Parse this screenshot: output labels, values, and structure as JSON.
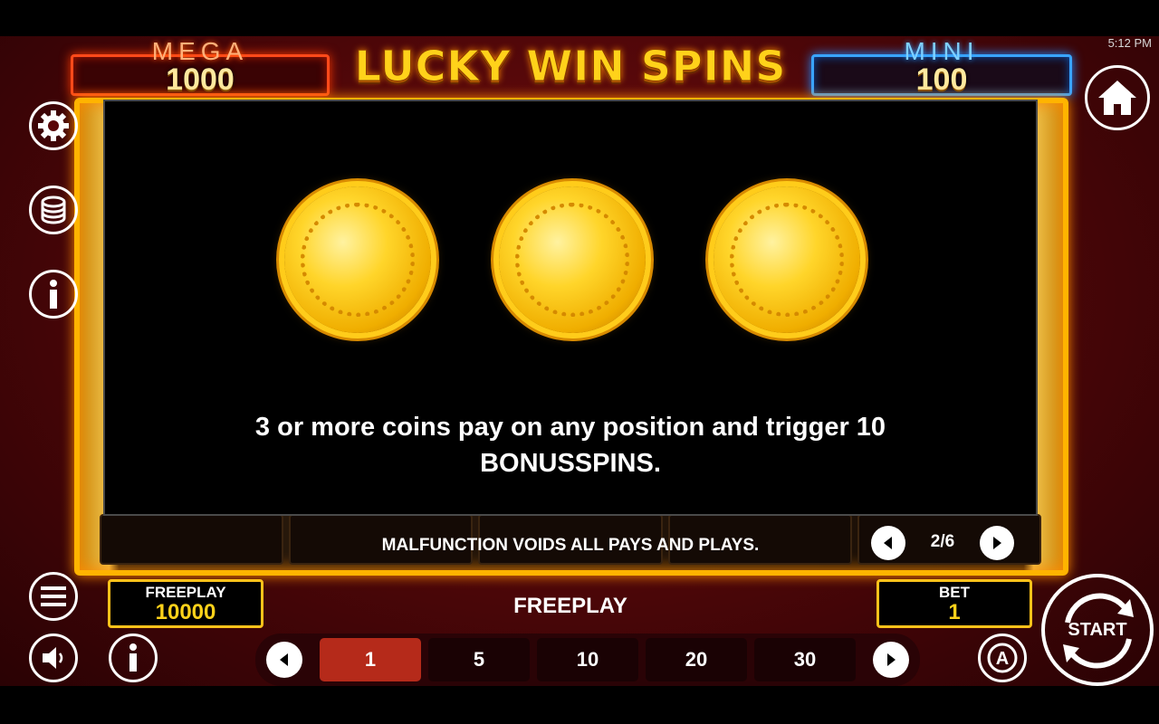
{
  "status_bar": {
    "time": "5:12 PM"
  },
  "jackpots": {
    "mega": {
      "label": "MEGA",
      "value": "1000"
    },
    "mini": {
      "label": "MINI",
      "value": "100"
    }
  },
  "logo": "LUCKY WIN SPINS",
  "info_panel": {
    "text_line1": "3 or more coins pay on any position and trigger 10",
    "text_line2": "BONUSSPINS."
  },
  "disclaimer": "MALFUNCTION VOIDS ALL PAYS AND PLAYS.",
  "pager": {
    "label": "2/6"
  },
  "freeplay_box": {
    "label": "FREEPLAY",
    "value": "10000"
  },
  "mode_label": "FREEPLAY",
  "bet_box": {
    "label": "BET",
    "value": "1"
  },
  "bet_options": [
    "1",
    "5",
    "10",
    "20",
    "30"
  ],
  "selected_bet": "1",
  "start_label": "START",
  "colors": {
    "frame_gold": "#ffb400",
    "mega_red": "#ff4a1a",
    "mini_blue": "#39a4ff",
    "active_bet": "#b52a1a"
  }
}
